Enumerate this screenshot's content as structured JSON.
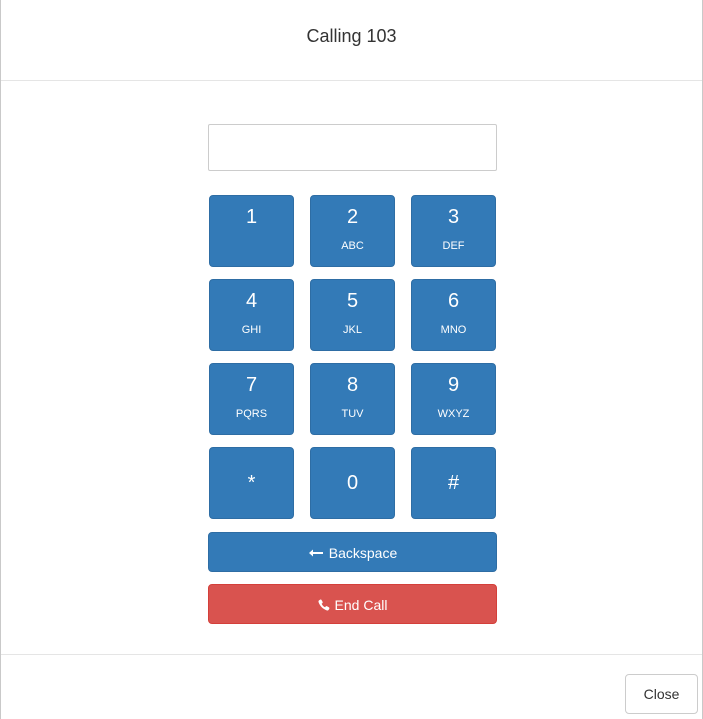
{
  "modal": {
    "title": "Calling 103",
    "dial_input": {
      "value": "",
      "placeholder": ""
    }
  },
  "keypad": {
    "keys": [
      {
        "digit": "1",
        "letters": ""
      },
      {
        "digit": "2",
        "letters": "ABC"
      },
      {
        "digit": "3",
        "letters": "DEF"
      },
      {
        "digit": "4",
        "letters": "GHI"
      },
      {
        "digit": "5",
        "letters": "JKL"
      },
      {
        "digit": "6",
        "letters": "MNO"
      },
      {
        "digit": "7",
        "letters": "PQRS"
      },
      {
        "digit": "8",
        "letters": "TUV"
      },
      {
        "digit": "9",
        "letters": "WXYZ"
      },
      {
        "digit": "*",
        "letters": ""
      },
      {
        "digit": "0",
        "letters": ""
      },
      {
        "digit": "#",
        "letters": ""
      }
    ]
  },
  "actions": {
    "backspace_label": "Backspace",
    "backspace_icon": "arrow-left-icon",
    "end_call_label": "End Call",
    "end_call_icon": "phone-icon"
  },
  "footer": {
    "close_label": "Close"
  },
  "colors": {
    "primary": "#337ab7",
    "danger": "#d9534f"
  }
}
